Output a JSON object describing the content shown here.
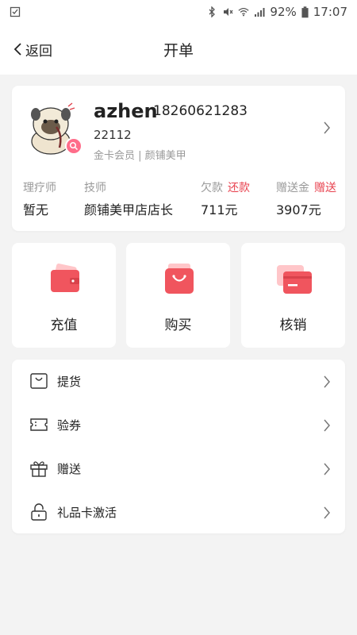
{
  "status_bar": {
    "battery": "92%",
    "time": "17:07",
    "icons": [
      "notification-icon",
      "bluetooth-icon",
      "mute-icon",
      "wifi-icon",
      "signal-icon",
      "battery-icon"
    ]
  },
  "header": {
    "back_label": "返回",
    "title": "开单"
  },
  "profile": {
    "name": "azhen",
    "phone": "18260621283",
    "member_id": "22112",
    "level": "金卡会员 | 颜铺美甲",
    "stats": [
      {
        "label": "理疗师",
        "value": "暂无",
        "action": ""
      },
      {
        "label": "技师",
        "value": "颜铺美甲店店长",
        "action": ""
      },
      {
        "label": "欠款",
        "value": "711元",
        "action": "还款"
      },
      {
        "label": "赠送金",
        "value": "3907元",
        "action": "赠送"
      }
    ]
  },
  "actions": [
    {
      "label": "充值",
      "icon": "wallet-icon"
    },
    {
      "label": "购买",
      "icon": "shopping-bag-icon"
    },
    {
      "label": "核销",
      "icon": "card-icon"
    }
  ],
  "menu": [
    {
      "label": "提货",
      "icon": "bag-icon"
    },
    {
      "label": "验券",
      "icon": "coupon-icon"
    },
    {
      "label": "赠送",
      "icon": "gift-icon"
    },
    {
      "label": "礼品卡激活",
      "icon": "lock-icon"
    }
  ],
  "colors": {
    "accent": "#e8424f",
    "tile_red": "#f0555e"
  }
}
